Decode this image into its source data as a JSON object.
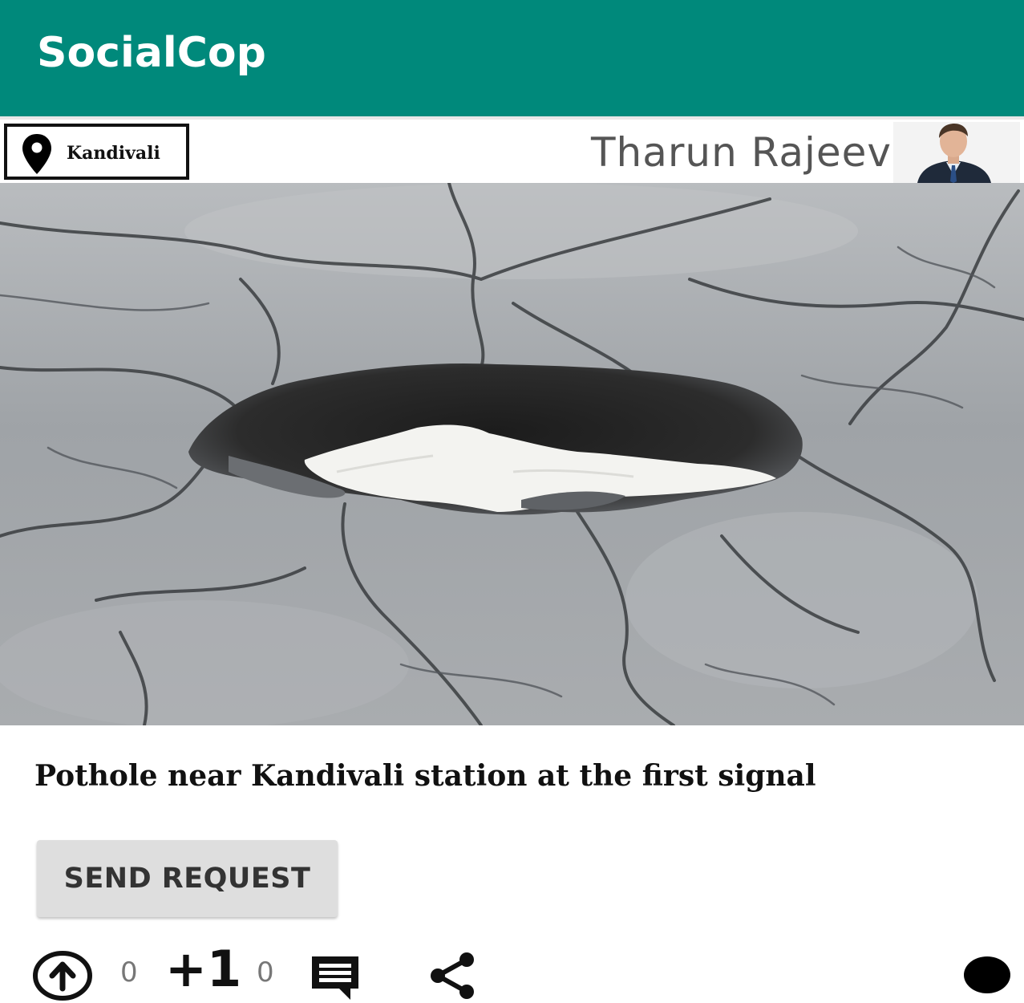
{
  "app": {
    "title": "SocialCop",
    "bar_color": "#00897b"
  },
  "post": {
    "location": "Kandivali",
    "location_icon": "map-pin-icon",
    "author_name": "Tharun Rajeev",
    "image_description_icon": "pothole-photo",
    "title": "Pothole near Kandivali station at the first signal",
    "send_request_label": "SEND REQUEST",
    "actions": {
      "upvote_icon": "arrow-up-circle-icon",
      "upvote_count": "0",
      "plus_one_label": "+1",
      "plus_one_count": "0",
      "comment_icon": "comment-icon",
      "share_icon": "share-icon"
    }
  }
}
